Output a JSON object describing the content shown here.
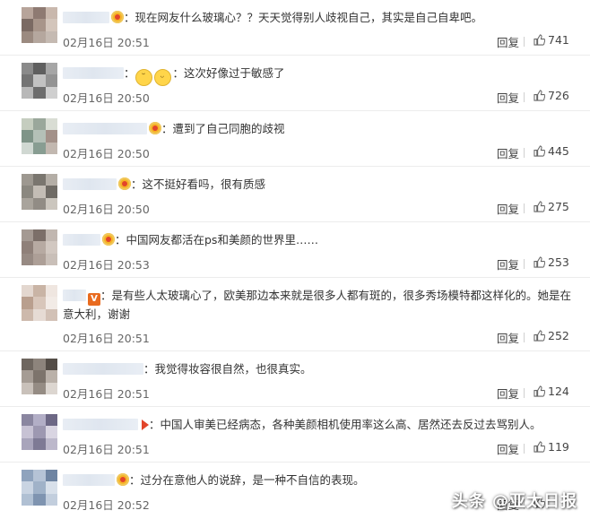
{
  "comments": [
    {
      "text": "：现在网友什么玻璃心？？天天觉得别人歧视自己，其实是自己自卑吧。",
      "date": "02月16日 20:51",
      "reply": "回复",
      "likes": "741",
      "badge": "crown-icon",
      "emoji": []
    },
    {
      "text": "：这次好像过于敏感了",
      "date": "02月16日 20:50",
      "reply": "回复",
      "likes": "726",
      "badge": "",
      "emoji": [
        "grin-sweat-emoji",
        "tears-of-joy-emoji"
      ]
    },
    {
      "text": "：遭到了自己同胞的歧视",
      "date": "02月16日 20:50",
      "reply": "回复",
      "likes": "445",
      "badge": "crown-icon",
      "emoji": []
    },
    {
      "text": "：这不挺好看吗，很有质感",
      "date": "02月16日 20:50",
      "reply": "回复",
      "likes": "275",
      "badge": "crown-icon",
      "emoji": []
    },
    {
      "text": "：中国网友都活在ps和美颜的世界里……",
      "date": "02月16日 20:53",
      "reply": "回复",
      "likes": "253",
      "badge": "crown-icon",
      "emoji": []
    },
    {
      "text": "：是有些人太玻璃心了，欧美那边本来就是很多人都有斑的，很多秀场模特都这样化的。她是在意大利，谢谢",
      "date": "02月16日 20:51",
      "reply": "回复",
      "likes": "252",
      "badge": "vip-icon",
      "emoji": []
    },
    {
      "text": "：我觉得妆容很自然，也很真实。",
      "date": "02月16日 20:51",
      "reply": "回复",
      "likes": "124",
      "badge": "",
      "emoji": []
    },
    {
      "text": "：中国人审美已经病态，各种美颜相机使用率这么高、居然还去反过去骂别人。",
      "date": "02月16日 20:51",
      "reply": "回复",
      "likes": "119",
      "badge": "flag-icon",
      "emoji": []
    },
    {
      "text": "：过分在意他人的说辞，是一种不自信的表现。",
      "date": "02月16日 20:52",
      "reply": "回复",
      "likes": "",
      "badge": "crown-icon",
      "emoji": []
    }
  ],
  "watermark": "头条 @亚太日报",
  "colors": {
    "text": "#333333",
    "meta": "#666666",
    "divider": "#ececec",
    "crown": "#f6b325",
    "vip": "#e96b1f"
  }
}
